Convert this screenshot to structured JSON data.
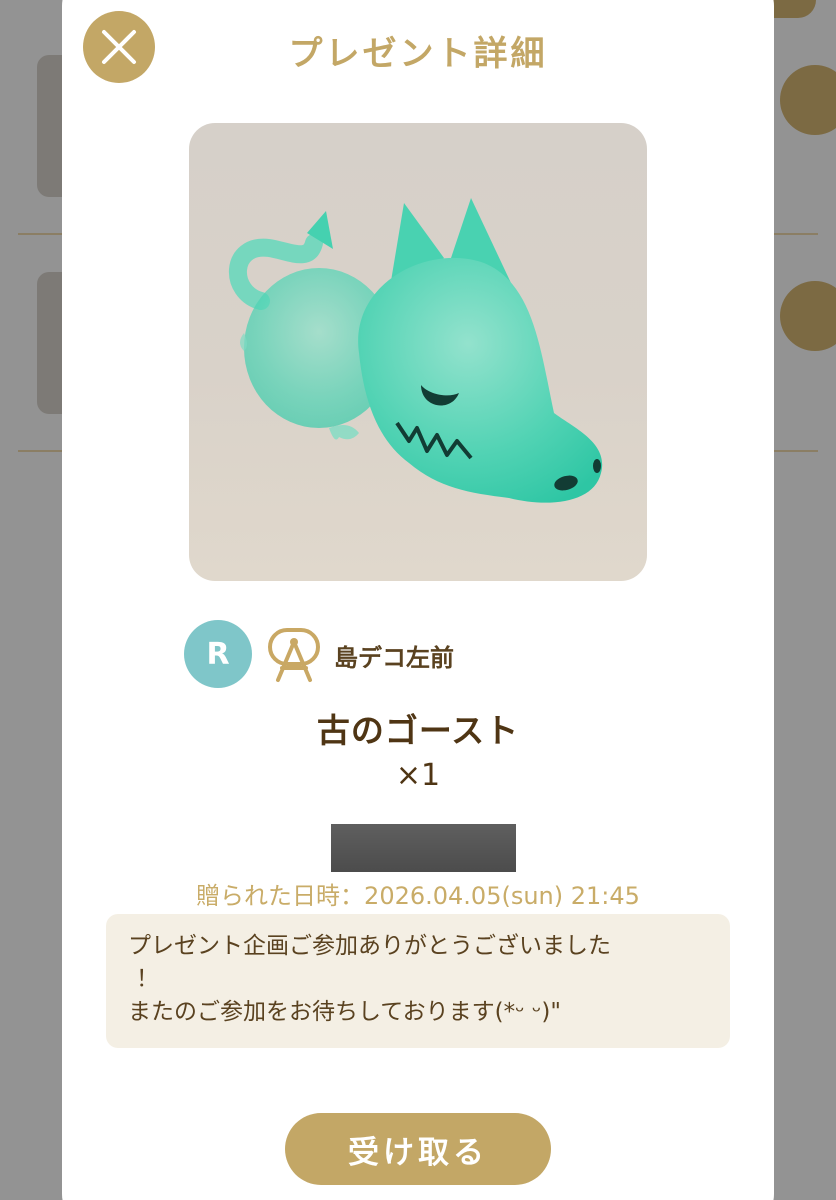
{
  "dialog": {
    "title": "プレゼント詳細",
    "close_icon": "close-icon"
  },
  "present": {
    "image_subject": "ghost-dragon-icon",
    "sender": {
      "avatar_initial": "R",
      "rank_icon": "rank-badge-icon",
      "name": "島デコ左前"
    },
    "item_name": "古のゴースト",
    "quantity": "×1",
    "sent_at": "贈られた日時：2026.04.05(sun) 21:45",
    "message_lines": [
      "プレゼント企画ご参加ありがとうございました",
      "！",
      "またのご参加をお待ちしております(*ᵕ ᵕ)\""
    ]
  },
  "actions": {
    "receive_label": "受け取る"
  },
  "colors": {
    "accent_gold": "#c3a766",
    "text_brown": "#4f3514",
    "date_gold": "#c9ac68",
    "message_bg": "#f4efe4",
    "avatar_teal": "#7fc6c9",
    "ghost_teal": "#45d6b5"
  }
}
